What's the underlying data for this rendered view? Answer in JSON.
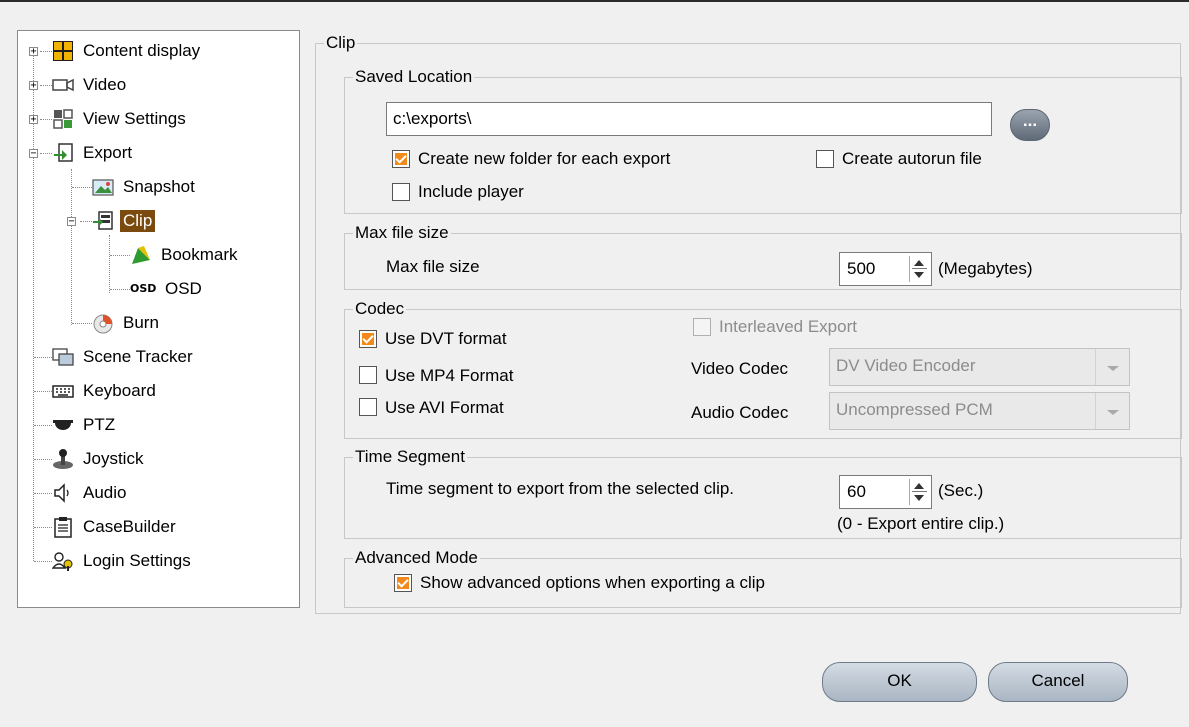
{
  "tree": {
    "items": [
      {
        "label": "Content display",
        "icon": "grid-icon"
      },
      {
        "label": "Video",
        "icon": "camera-icon"
      },
      {
        "label": "View Settings",
        "icon": "view-settings-icon"
      },
      {
        "label": "Export",
        "icon": "export-icon"
      },
      {
        "label": "Snapshot",
        "icon": "snapshot-icon"
      },
      {
        "label": "Clip",
        "icon": "clip-icon"
      },
      {
        "label": "Bookmark",
        "icon": "bookmark-icon"
      },
      {
        "label": "OSD",
        "icon": "osd-icon",
        "icon_text": "OSD"
      },
      {
        "label": "Burn",
        "icon": "burn-icon"
      },
      {
        "label": "Scene Tracker",
        "icon": "scene-tracker-icon"
      },
      {
        "label": "Keyboard",
        "icon": "keyboard-icon"
      },
      {
        "label": "PTZ",
        "icon": "ptz-icon"
      },
      {
        "label": "Joystick",
        "icon": "joystick-icon"
      },
      {
        "label": "Audio",
        "icon": "audio-icon"
      },
      {
        "label": "CaseBuilder",
        "icon": "casebuilder-icon"
      },
      {
        "label": "Login Settings",
        "icon": "login-settings-icon"
      }
    ],
    "selected": "Clip",
    "expander_collapsed": "+",
    "expander_expanded": "−"
  },
  "clip": {
    "title": "Clip",
    "saved_location": {
      "title": "Saved Location",
      "path": "c:\\exports\\",
      "browse_label": "...",
      "create_folder_label": "Create new folder for each export",
      "create_folder_checked": true,
      "create_autorun_label": "Create autorun file",
      "create_autorun_checked": false,
      "include_player_label": "Include player",
      "include_player_checked": false
    },
    "max_file_size": {
      "title": "Max file size",
      "label": "Max file size",
      "value": "500",
      "unit": "(Megabytes)"
    },
    "codec": {
      "title": "Codec",
      "use_dvt_label": "Use DVT format",
      "use_dvt_checked": true,
      "use_mp4_label": "Use MP4 Format",
      "use_mp4_checked": false,
      "use_avi_label": "Use AVI Format",
      "use_avi_checked": false,
      "interleaved_label": "Interleaved Export",
      "interleaved_checked": false,
      "video_codec_label": "Video Codec",
      "video_codec_value": "DV Video Encoder",
      "audio_codec_label": "Audio Codec",
      "audio_codec_value": "Uncompressed PCM"
    },
    "time_segment": {
      "title": "Time Segment",
      "label": "Time segment to export from the selected clip.",
      "value": "60",
      "unit": "(Sec.)",
      "hint": "(0 - Export entire clip.)"
    },
    "advanced_mode": {
      "title": "Advanced Mode",
      "show_advanced_label": "Show advanced options when exporting a clip",
      "show_advanced_checked": true
    }
  },
  "buttons": {
    "ok_label": "OK",
    "cancel_label": "Cancel"
  },
  "colors": {
    "selection": "#7a4a0f",
    "check_accent": "#f28a1b"
  }
}
